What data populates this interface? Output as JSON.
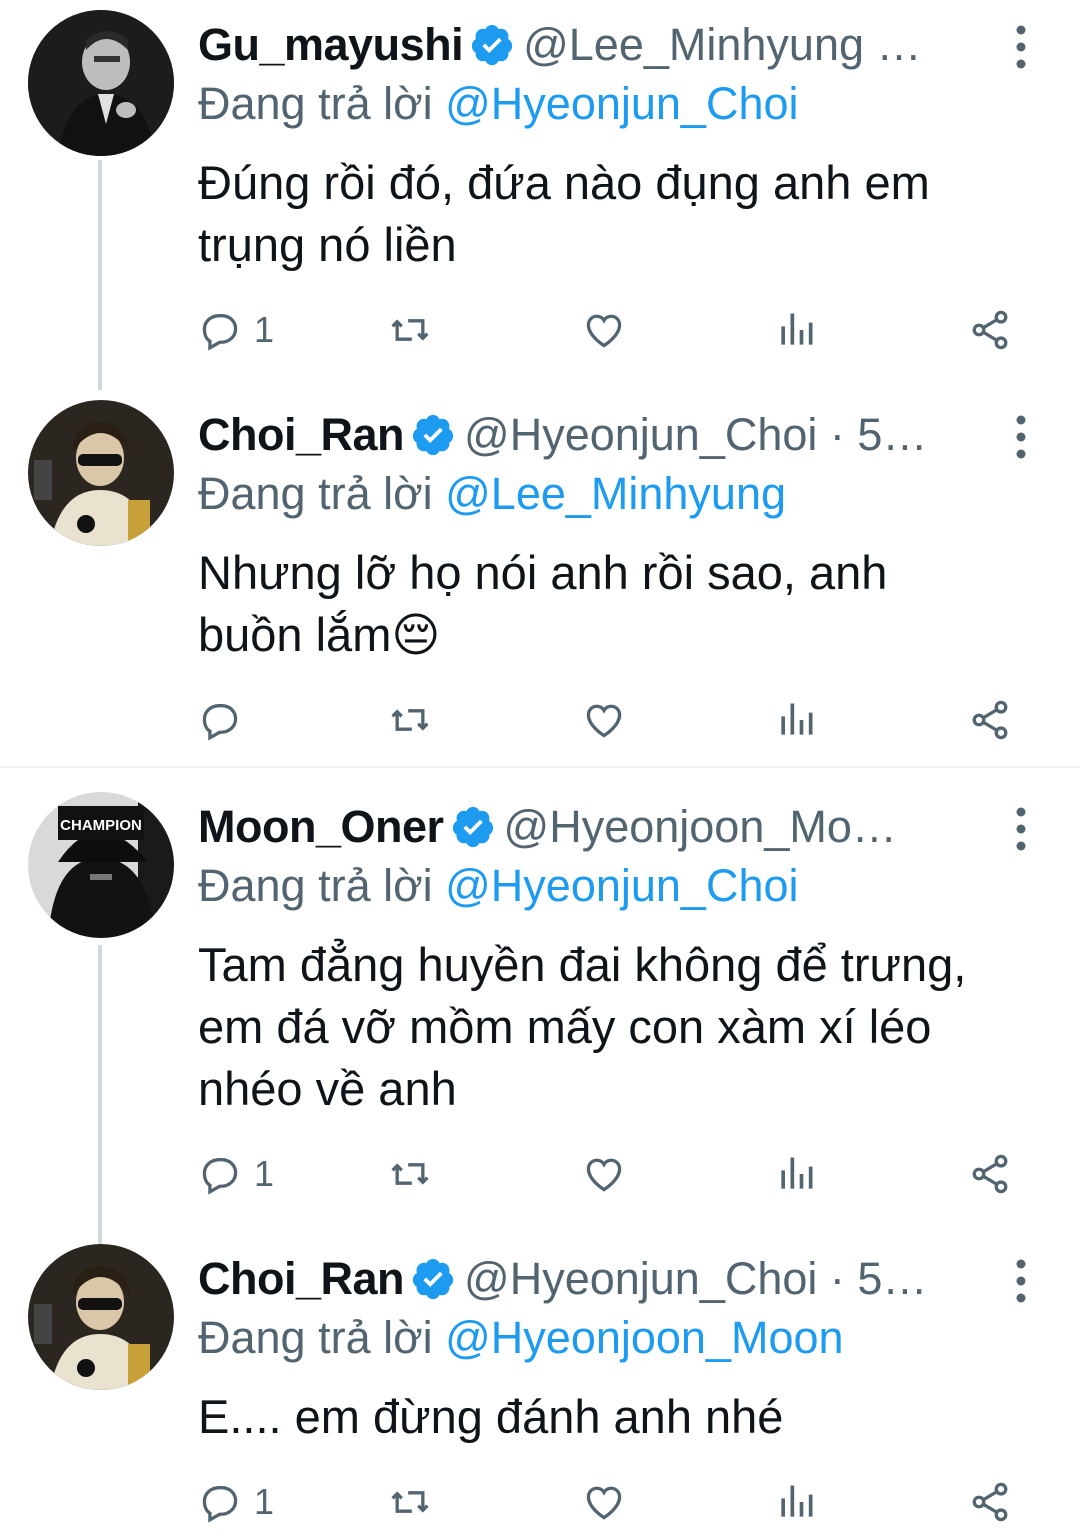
{
  "colors": {
    "accent": "#1d9bf0",
    "secondary_text": "#536471",
    "thread_line": "#cfd9de"
  },
  "tweets": [
    {
      "name": "Gu_mayushi",
      "handle": "@Lee_Minhyung …",
      "reply_prefix": "Đang trả lời ",
      "reply_to": "@Hyeonjun_Choi",
      "body_lines": [
        "Đúng rồi đó, đứa nào đụng anh em",
        "trụng nó liền"
      ],
      "reply_count": "1",
      "avatar": "portrait-mono"
    },
    {
      "name": "Choi_Ran",
      "handle": "@Hyeonjun_Choi · 5…",
      "reply_prefix": "Đang trả lời ",
      "reply_to": "@Lee_Minhyung",
      "body_lines": [
        "Nhưng lỡ họ nói anh rồi sao, anh",
        "buồn lắm😔"
      ],
      "reply_count": "",
      "avatar": "portrait-sunglasses"
    },
    {
      "name": "Moon_Oner",
      "handle": "@Hyeonjoon_Mo…",
      "reply_prefix": "Đang trả lời ",
      "reply_to": "@Hyeonjun_Choi",
      "body_lines": [
        "Tam đẳng huyền đai không để trưng,",
        "em đá vỡ mồm mấy con xàm xí léo",
        "nhéo về anh"
      ],
      "reply_count": "1",
      "avatar": "champion-hoodie",
      "avatar_text": "CHAMPION"
    },
    {
      "name": "Choi_Ran",
      "handle": "@Hyeonjun_Choi · 5…",
      "reply_prefix": "Đang trả lời ",
      "reply_to": "@Hyeonjoon_Moon",
      "body_lines": [
        "E.... em đừng đánh anh nhé"
      ],
      "reply_count": "1",
      "avatar": "portrait-sunglasses"
    }
  ]
}
